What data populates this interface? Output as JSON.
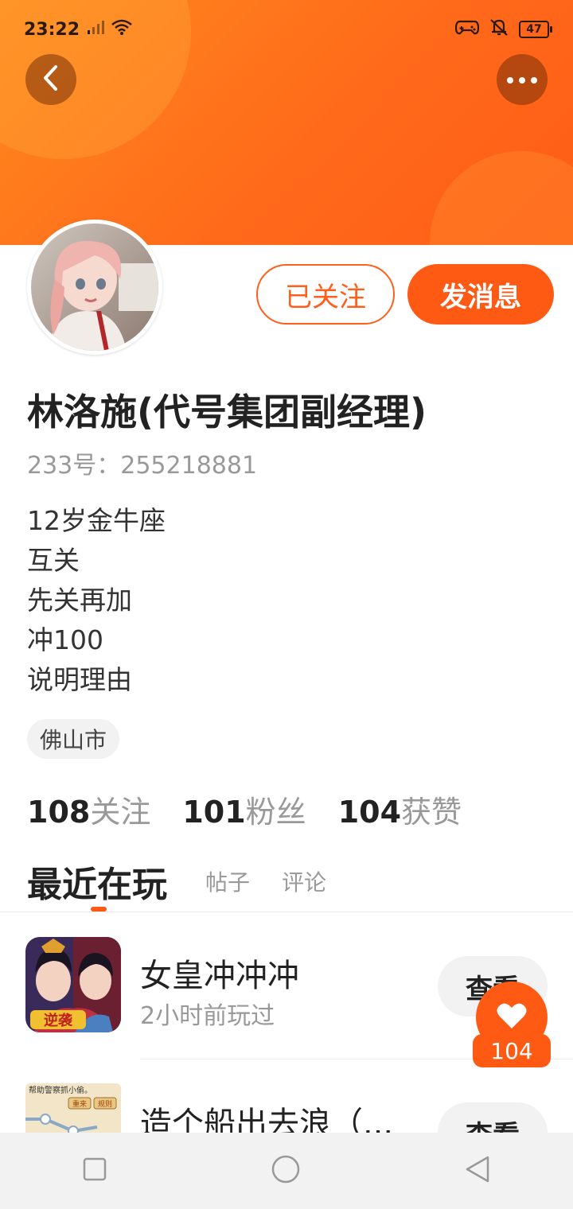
{
  "status_bar": {
    "time": "23:22",
    "battery": "47"
  },
  "profile": {
    "follow_button": "已关注",
    "message_button": "发消息",
    "name": "林洛施(代号集团副经理)",
    "uid": "233号：255218881",
    "bio": [
      "12岁金牛座",
      "互关",
      "先关再加",
      "冲100",
      "说明理由"
    ],
    "location": "佛山市"
  },
  "stats": [
    {
      "number": "108",
      "label": "关注"
    },
    {
      "number": "101",
      "label": "粉丝"
    },
    {
      "number": "104",
      "label": "获赞"
    }
  ],
  "tabs": {
    "active": "最近在玩",
    "posts": "帖子",
    "comments": "评论"
  },
  "games": [
    {
      "title": "女皇冲冲冲",
      "subtitle": "2小时前玩过",
      "button": "查看",
      "icon_text": "逆袭"
    },
    {
      "title": "造个船出去浪（...",
      "button": "查看",
      "icon_text_top": "帮助警察抓小偷。",
      "icon_btn1": "重来",
      "icon_btn2": "规则"
    }
  ],
  "like_badge": {
    "count": "104"
  },
  "colors": {
    "accent": "#ff5a14",
    "header": "#ff7a1c"
  }
}
